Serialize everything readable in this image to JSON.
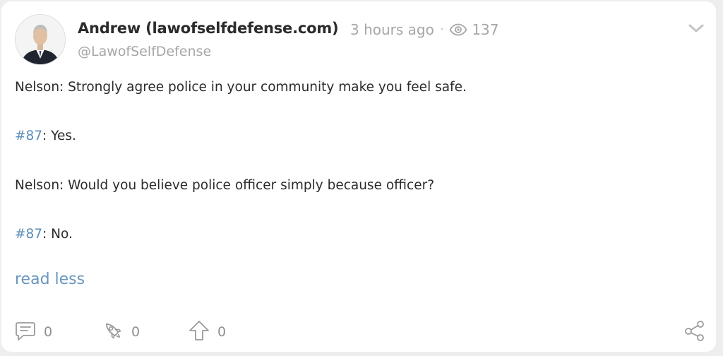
{
  "post": {
    "author_name": "Andrew (lawofselfdefense.com)",
    "time_ago": "3 hours ago",
    "separator": "·",
    "views": "137",
    "handle": "@LawofSelfDefense",
    "lines": [
      {
        "speaker": "Nelson",
        "text": ": Strongly agree police in your community make you feel safe."
      },
      {
        "ref": "#87",
        "text": ": Yes."
      },
      {
        "speaker": "Nelson",
        "text": ": Would you believe police officer simply because officer?"
      },
      {
        "ref": "#87",
        "text": ": No."
      }
    ],
    "read_less": "read less"
  },
  "actions": {
    "comments": "0",
    "likes": "0",
    "upvotes": "0"
  },
  "icons": {
    "menu": "chevron-down-icon",
    "views": "eye-icon",
    "comment": "comment-icon",
    "like": "rocket-icon",
    "upvote": "arrow-up-icon",
    "share": "share-icon"
  },
  "colors": {
    "link": "#5b8db8",
    "muted": "#a6a6a6",
    "text": "#2b2b2b"
  }
}
